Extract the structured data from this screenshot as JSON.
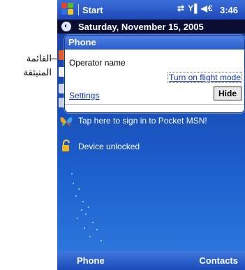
{
  "callout": {
    "line1": "القائمة",
    "line2": "المنبثقة"
  },
  "title_bar": {
    "title": "Start",
    "status_icons": "⇄ Y▌◀€",
    "time": "3:46"
  },
  "today": {
    "date": "Saturday, November 15, 2005"
  },
  "popup": {
    "title": "Phone",
    "operator_name": "Operator name",
    "flight_mode_link": "Turn on flight mode",
    "settings_link": "Settings",
    "hide_button": "Hide"
  },
  "msn": {
    "text": "Tap here to sign in to Pocket MSN!"
  },
  "device_lock": {
    "text": "Device unlocked"
  },
  "softkeys": {
    "left": "Phone",
    "right": "Contacts"
  },
  "colors": {
    "title_bar": "#2757c8",
    "background_top": "#1c3f9a",
    "background_bottom": "#2f7be0",
    "link": "#1030b8"
  }
}
